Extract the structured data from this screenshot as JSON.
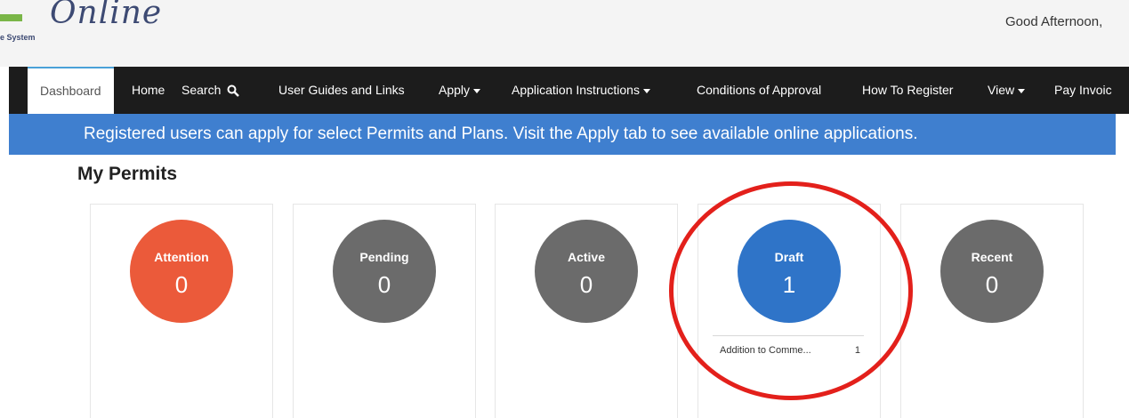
{
  "header": {
    "logo_text": "Online",
    "logo_subtext": "e System",
    "greeting": "Good Afternoon,"
  },
  "nav": {
    "items": [
      {
        "label": "Dashboard",
        "active": true
      },
      {
        "label": "Home"
      },
      {
        "label": "Search",
        "icon": "search-icon"
      },
      {
        "label": "User Guides and Links"
      },
      {
        "label": "Apply",
        "dropdown": true
      },
      {
        "label": "Application Instructions",
        "dropdown": true
      },
      {
        "label": "Conditions of Approval"
      },
      {
        "label": "How To Register"
      },
      {
        "label": "View",
        "dropdown": true
      },
      {
        "label": "Pay Invoic"
      }
    ]
  },
  "banner": {
    "text": "Registered users can apply for select Permits and Plans.  Visit the Apply tab to see available online applications."
  },
  "section": {
    "title": "My Permits"
  },
  "cards": [
    {
      "label": "Attention",
      "count": "0",
      "color": "#eb5a3a"
    },
    {
      "label": "Pending",
      "count": "0",
      "color": "#6b6b6b"
    },
    {
      "label": "Active",
      "count": "0",
      "color": "#6b6b6b"
    },
    {
      "label": "Draft",
      "count": "1",
      "color": "#2f74c8",
      "items": [
        {
          "name": "Addition to Comme...",
          "count": "1"
        }
      ]
    },
    {
      "label": "Recent",
      "count": "0",
      "color": "#6b6b6b"
    }
  ],
  "colors": {
    "navbar": "#1c1c1c",
    "banner": "#3f7fcf",
    "annotation": "#e3201b"
  }
}
